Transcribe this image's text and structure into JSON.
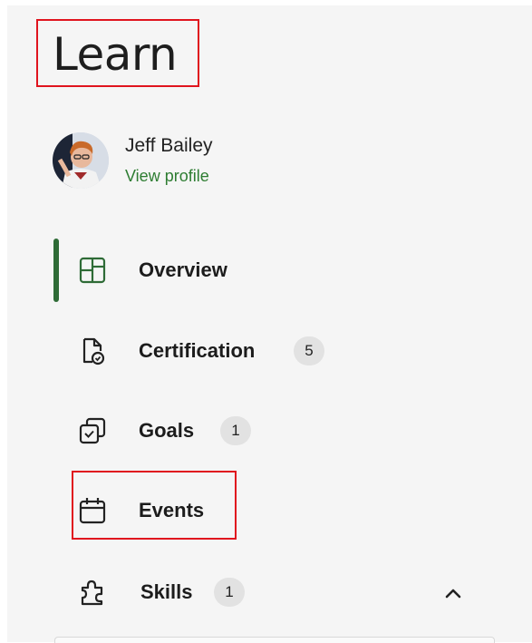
{
  "header": {
    "title": "Learn"
  },
  "user": {
    "name": "Jeff Bailey",
    "profile_link": "View profile"
  },
  "nav": {
    "items": [
      {
        "label": "Overview",
        "icon": "layout-grid-icon",
        "badge": null,
        "active": true
      },
      {
        "label": "Certification",
        "icon": "certificate-doc-icon",
        "badge": "5"
      },
      {
        "label": "Goals",
        "icon": "goals-checkbox-icon",
        "badge": "1"
      },
      {
        "label": "Events",
        "icon": "calendar-icon",
        "badge": null
      },
      {
        "label": "Skills",
        "icon": "puzzle-icon",
        "badge": "1",
        "expanded": true
      }
    ]
  },
  "colors": {
    "accent": "#2e6b36",
    "link": "#2e7d32",
    "highlight_box": "#e0141e",
    "badge_bg": "#e2e2e2"
  }
}
